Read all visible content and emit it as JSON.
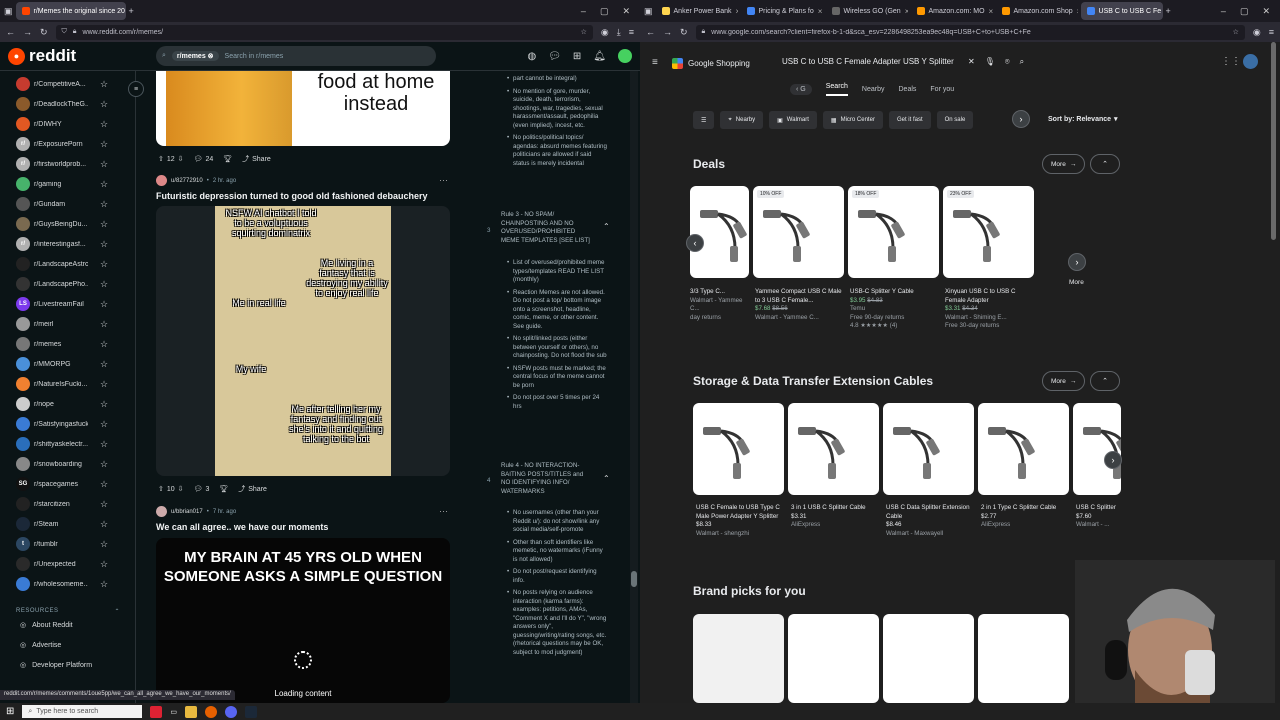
{
  "left": {
    "tab_title": "r/Memes the original since 20",
    "url": "www.reddit.com/r/memes/",
    "brand": "reddit",
    "search_chip": "r/memes",
    "search_placeholder": "Search in r/memes",
    "sidebar": [
      {
        "name": "r/CompetitiveA...",
        "color": "#c63b2f",
        "g": ""
      },
      {
        "name": "r/DeadlockTheG...",
        "color": "#8b5a2b",
        "g": ""
      },
      {
        "name": "r/DIWHY",
        "color": "#e25822",
        "g": ""
      },
      {
        "name": "r/ExposurePorn",
        "color": "#b0b0b0",
        "g": "r/"
      },
      {
        "name": "r/firstworldprob...",
        "color": "#b0b0b0",
        "g": "r/"
      },
      {
        "name": "r/gaming",
        "color": "#47b36b",
        "g": ""
      },
      {
        "name": "r/Gundam",
        "color": "#555",
        "g": ""
      },
      {
        "name": "r/GuysBeingDu...",
        "color": "#7a6a50",
        "g": ""
      },
      {
        "name": "r/interestingasf...",
        "color": "#b0b0b0",
        "g": "r/"
      },
      {
        "name": "r/LandscapeAstro",
        "color": "#222",
        "g": ""
      },
      {
        "name": "r/LandscapePho...",
        "color": "#333",
        "g": ""
      },
      {
        "name": "r/LivestreamFail",
        "color": "#7c3aed",
        "g": "LS"
      },
      {
        "name": "r/meirl",
        "color": "#999",
        "g": ""
      },
      {
        "name": "r/memes",
        "color": "#777",
        "g": ""
      },
      {
        "name": "r/MMORPG",
        "color": "#4a90d9",
        "g": ""
      },
      {
        "name": "r/NatureIsFucki...",
        "color": "#f08030",
        "g": ""
      },
      {
        "name": "r/nope",
        "color": "#ccc",
        "g": ""
      },
      {
        "name": "r/Satisfyingasfuck",
        "color": "#3a7bd5",
        "g": ""
      },
      {
        "name": "r/shittyaskelectr...",
        "color": "#2a6ebb",
        "g": ""
      },
      {
        "name": "r/snowboarding",
        "color": "#888",
        "g": ""
      },
      {
        "name": "r/spacegames",
        "color": "#111",
        "g": "SG"
      },
      {
        "name": "r/starcitizen",
        "color": "#222",
        "g": ""
      },
      {
        "name": "r/Steam",
        "color": "#1b2838",
        "g": ""
      },
      {
        "name": "r/tumblr",
        "color": "#2c4762",
        "g": "t"
      },
      {
        "name": "r/Unexpected",
        "color": "#2a2a2a",
        "g": ""
      },
      {
        "name": "r/wholesomeme...",
        "color": "#3a7bd5",
        "g": ""
      }
    ],
    "resources_label": "RESOURCES",
    "resources": [
      "About Reddit",
      "Advertise",
      "Developer Platform"
    ],
    "post1": {
      "meme_text": "food at home instead",
      "votes": "12",
      "comments": "24",
      "share": "Share"
    },
    "post2": {
      "user": "u/82772910",
      "time": "2 hr. ago",
      "title": "Futuristic depression turned to good old fashioned debauchery",
      "captions": [
        "NSFW AI chatbot I told to be a voluptuous squirting dominatrix",
        "Me living in a fantasy that is destroying my ability to enjoy real life",
        "Me in real life",
        "My wife",
        "Me after telling her my fantasy and finding out she's into it and quitting talking to the bot"
      ],
      "votes": "10",
      "comments": "3",
      "share": "Share"
    },
    "post3": {
      "user": "u/bbrian017",
      "time": "7 hr. ago",
      "title": "We can all agree.. we have our moments",
      "meme_text": "MY BRAIN AT 45 YRS OLD WHEN SOMEONE ASKS A SIMPLE QUESTION",
      "loading": "Loading content"
    },
    "rules_top": [
      "part cannot be integral)",
      "No mention of gore, murder, suicide, death, terrorism, shootings, war, tragedies, sexual harassment/assault, pedophilia (even implied), incest, etc.",
      "No politics/political topics/ agendas: absurd memes featuring politicians are allowed if said status is merely incidental"
    ],
    "rule3": {
      "num": "3",
      "title": "Rule 3 - NO SPAM/ CHAINPOSTING AND NO OVERUSED/PROHIBITED MEME TEMPLATES [SEE LIST]",
      "items": [
        "List of overused/prohibited meme types/templates READ THE LIST (monthly)",
        "Reaction Memes are not allowed. Do not post a top/ bottom image onto a screenshot, headline, comic, meme, or other content. See guide.",
        "No split/linked posts (either between yourself or others), no chainposting. Do not flood the sub",
        "NSFW posts must be marked; the central focus of the meme cannot be porn",
        "Do not post over 5 times per 24 hrs"
      ]
    },
    "rule4": {
      "num": "4",
      "title": "Rule 4 - NO INTERACTION-BAITING POSTS/TITLES and NO IDENTIFYING INFO/ WATERMARKS",
      "items": [
        "No usernames (other than your Reddit u/): do not show/link any social media/self-promote",
        "Other than soft identifiers like memetic, no watermarks (iFunny is not allowed)",
        "Do not post/request identifying info.",
        "No posts relying on audience interaction (karma farms): examples: petitions, AMAs, \"Comment X and I'll do Y\", \"wrong answers only\", guessing/writing/rating songs, etc. (rhetorical questions may be OK, subject to mod judgment)"
      ]
    },
    "status_url": "reddit.com/r/memes/comments/1oue5pp/we_can_all_agree_we_have_our_moments/"
  },
  "right": {
    "tabs": [
      {
        "t": "Anker Power Bank",
        "c": "#ffd54f"
      },
      {
        "t": "Pricing & Plans fo",
        "c": "#4285f4"
      },
      {
        "t": "Wireless GO (Gen",
        "c": "#666"
      },
      {
        "t": "Amazon.com: MO",
        "c": "#ff9900"
      },
      {
        "t": "Amazon.com Shop",
        "c": "#ff9900"
      },
      {
        "t": "USB C to USB C Fe",
        "c": "#4285f4"
      }
    ],
    "url": "www.google.com/search?client=firefox-b-1-d&sca_esv=2286498253ea9ec48q=USB+C+to+USB+C+Female+Adapter...",
    "brand": "Google Shopping",
    "query": "USB C to USB C Female Adapter USB Y Splitter",
    "gtabs": [
      "Search",
      "Nearby",
      "Deals",
      "For you"
    ],
    "filters": [
      "Nearby",
      "Walmart",
      "Micro Center",
      "Get it fast",
      "On sale"
    ],
    "sort": "Sort by: Relevance",
    "deals_title": "Deals",
    "more": "More",
    "deals": [
      {
        "badge": "",
        "title": "3/3 Type C...",
        "price": "",
        "old": "",
        "seller": "Walmart - Yammee C...",
        "extra": "day returns"
      },
      {
        "badge": "10% OFF",
        "title": "Yammee Compact USB C Male to 3 USB C Female...",
        "price": "$7.68",
        "old": "$8.56",
        "seller": "Walmart - Yammee C...",
        "extra": ""
      },
      {
        "badge": "18% OFF",
        "title": "USB-C Splitter Y Cable",
        "price": "$3.95",
        "old": "$4.83",
        "seller": "Temu",
        "extra": "Free 90-day returns",
        "rating": "4.8 ★★★★★ (4)"
      },
      {
        "badge": "23% OFF",
        "title": "Xinyuan USB C to USB C Female Adapter",
        "price": "$3.31",
        "old": "$4.34",
        "seller": "Walmart - Shiming E...",
        "extra": "Free 30-day returns"
      }
    ],
    "storage_title": "Storage & Data Transfer Extension Cables",
    "storage": [
      {
        "title": "USB C Female to USB Type C Male Power Adapter Y Splitter",
        "price": "$8.33",
        "seller": "Walmart - shengzhi"
      },
      {
        "title": "3 in 1 USB C Splitter Cable",
        "price": "$3.31",
        "seller": "AliExpress"
      },
      {
        "title": "USB C Data Splitter Extension Cable",
        "price": "$8.46",
        "seller": "Walmart - Maxwayell"
      },
      {
        "title": "2 in 1 Type C Splitter Cable",
        "price": "$2.77",
        "seller": "AliExpress"
      },
      {
        "title": "USB C Splitter",
        "price": "$7.60",
        "seller": "Walmart - ..."
      }
    ],
    "brand_title": "Brand picks for you"
  },
  "taskbar": {
    "search": "Type here to search"
  }
}
